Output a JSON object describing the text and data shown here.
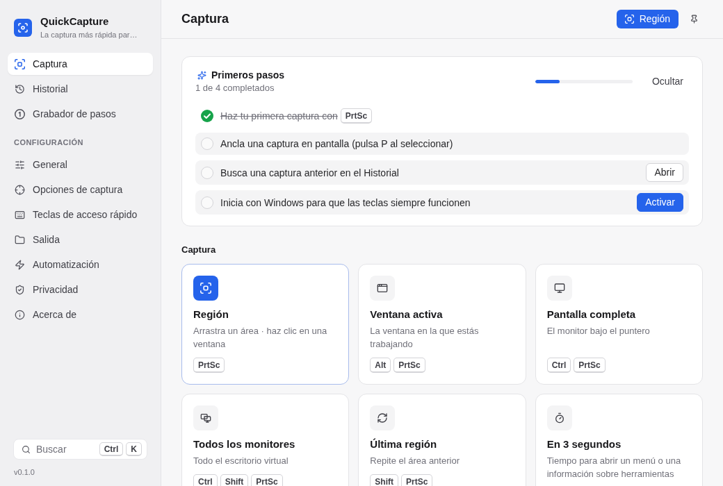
{
  "sidebar": {
    "brand": {
      "title": "QuickCapture",
      "subtitle": "La captura más rápida par…"
    },
    "nav": [
      {
        "label": "Captura",
        "selected": true
      },
      {
        "label": "Historial",
        "selected": false
      },
      {
        "label": "Grabador de pasos",
        "selected": false
      }
    ],
    "settings_heading": "CONFIGURACIÓN",
    "settings": [
      {
        "label": "General",
        "selected": false
      },
      {
        "label": "Opciones de captura",
        "selected": false
      },
      {
        "label": "Teclas de acceso rápido",
        "selected": false
      },
      {
        "label": "Salida",
        "selected": false
      },
      {
        "label": "Automatización",
        "selected": false
      },
      {
        "label": "Privacidad",
        "selected": false
      },
      {
        "label": "Acerca de",
        "selected": false
      }
    ],
    "search": {
      "placeholder": "Buscar",
      "keys": [
        "Ctrl",
        "K"
      ]
    },
    "version": "v0.1.0"
  },
  "header": {
    "title": "Captura",
    "button": "Región"
  },
  "onboarding": {
    "title": "Primeros pasos",
    "progress_text": "1 de 4 completados",
    "level": 0.25,
    "hide": "Ocultar",
    "steps": [
      {
        "text": "Haz tu primera captura con",
        "keys": [
          "PrtSc"
        ],
        "done": true
      },
      {
        "text": "Ancla una captura en pantalla (pulsa P al seleccionar)",
        "done": false
      },
      {
        "text": "Busca una captura anterior en el Historial",
        "done": false,
        "action": {
          "label": "Abrir",
          "kind": "secondary"
        }
      },
      {
        "text": "Inicia con Windows para que las teclas siempre funcionen",
        "done": false,
        "action": {
          "label": "Activar",
          "kind": "primary"
        }
      }
    ]
  },
  "capture": {
    "heading": "Captura",
    "modes": [
      {
        "title": "Región",
        "description": "Arrastra un área · haz clic en una ventana",
        "keys": [
          "PrtSc"
        ],
        "selected": true
      },
      {
        "title": "Ventana activa",
        "description": "La ventana en la que estás trabajando",
        "keys": [
          "Alt",
          "PrtSc"
        ],
        "selected": false
      },
      {
        "title": "Pantalla completa",
        "description": "El monitor bajo el puntero",
        "keys": [
          "Ctrl",
          "PrtSc"
        ],
        "selected": false
      },
      {
        "title": "Todos los monitores",
        "description": "Todo el escritorio virtual",
        "keys": [
          "Ctrl",
          "Shift",
          "PrtSc"
        ],
        "selected": false
      },
      {
        "title": "Última región",
        "description": "Repite el área anterior",
        "keys": [
          "Shift",
          "PrtSc"
        ],
        "selected": false
      },
      {
        "title": "En 3 segundos",
        "description": "Tiempo para abrir un menú o una información sobre herramientas",
        "selected": false
      }
    ]
  }
}
